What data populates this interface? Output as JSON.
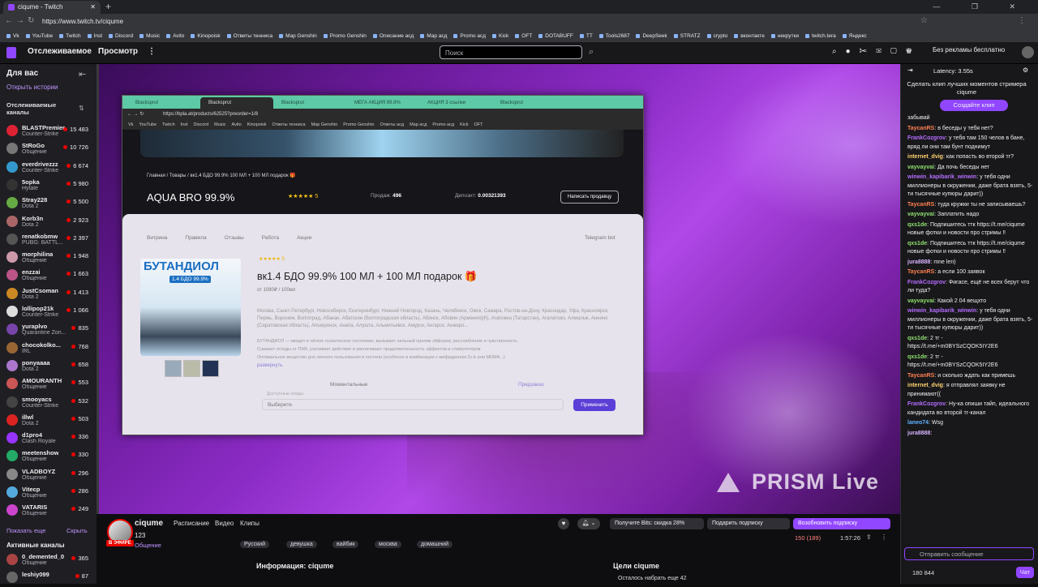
{
  "browser": {
    "tab_title": "ciqume - Twitch",
    "new_tab": "+",
    "url": "https://www.twitch.tv/ciqume",
    "window_controls": "— ❐ ✕",
    "bookmarks": [
      "Vk",
      "YouTube",
      "Twitch",
      "Inst",
      "Discord",
      "Music",
      "Avito",
      "Kinopoisk",
      "Ответы тенниса",
      "Map Genshin",
      "Promo Genshin",
      "Описание асд",
      "Map асд",
      "Promo асд",
      "Kick",
      "OFT",
      "DOTABUFF",
      "TT",
      "Tools2687",
      "DeepSeek",
      "STRATZ",
      "crypto",
      "вконтакте",
      "некрутки",
      "twitch.tera",
      "Яндекс"
    ]
  },
  "topnav": {
    "following": "Отслеживаемое",
    "browse": "Просмотр",
    "more": "⋮",
    "search_placeholder": "Поиск",
    "ad_free": "Без рекламы бесплатно"
  },
  "sidebar": {
    "for_you": "Для вас",
    "history": "Открыть истории",
    "followed_header": "Отслеживаемые каналы",
    "channels": [
      {
        "name": "BLASTPremier",
        "game": "Counter-Strike",
        "viewers": "15 483",
        "color": "#d23"
      },
      {
        "name": "StRoGo",
        "game": "Общение",
        "viewers": "10 726",
        "color": "#777"
      },
      {
        "name": "everdrivezzz",
        "game": "Counter-Strike",
        "viewers": "6 674",
        "color": "#39c"
      },
      {
        "name": "5opka",
        "game": "Hytale",
        "viewers": "5 980",
        "color": "#333"
      },
      {
        "name": "Stray228",
        "game": "Dota 2",
        "viewers": "5 500",
        "color": "#6a4"
      },
      {
        "name": "Korb3n",
        "game": "Dota 2",
        "viewers": "2 923",
        "color": "#a66"
      },
      {
        "name": "renatkobmw",
        "game": "PUBG: BATTL...",
        "viewers": "2 397",
        "color": "#555"
      },
      {
        "name": "morphilina",
        "game": "Общение",
        "viewers": "1 948",
        "color": "#c9a"
      },
      {
        "name": "enzzai",
        "game": "Общение",
        "viewers": "1 663",
        "color": "#b58"
      },
      {
        "name": "JustCsoman",
        "game": "Dota 2",
        "viewers": "1 413",
        "color": "#c82"
      },
      {
        "name": "lollipop21k",
        "game": "Counter-Strike",
        "viewers": "1 066",
        "color": "#ddd"
      },
      {
        "name": "yuraplvo",
        "game": "Quarantine Zon...",
        "viewers": "835",
        "color": "#74a"
      },
      {
        "name": "chocokolko...",
        "game": "IRL",
        "viewers": "768",
        "color": "#963"
      },
      {
        "name": "ponyaaaa",
        "game": "Dota 2",
        "viewers": "658",
        "color": "#a7c"
      },
      {
        "name": "AMOURANTH",
        "game": "Общение",
        "viewers": "553",
        "color": "#c55"
      },
      {
        "name": "smooyacs",
        "game": "Counter-Strike",
        "viewers": "532",
        "color": "#444"
      },
      {
        "name": "illwl",
        "game": "Dota 2",
        "viewers": "503",
        "color": "#d22"
      },
      {
        "name": "d1pro4",
        "game": "Clash Royale",
        "viewers": "336",
        "color": "#93f"
      },
      {
        "name": "meetenshow",
        "game": "Общение",
        "viewers": "330",
        "color": "#2a6"
      },
      {
        "name": "VLADBOYZ",
        "game": "Общение",
        "viewers": "296",
        "color": "#888"
      },
      {
        "name": "Vitecp",
        "game": "Общение",
        "viewers": "286",
        "color": "#5ad"
      },
      {
        "name": "VATARIS",
        "game": "Общение",
        "viewers": "249",
        "color": "#c4c"
      }
    ],
    "show_more": "Показать еще",
    "hide": "Скрыть",
    "active_header": "Активные каналы",
    "active_channels": [
      {
        "name": "0_demented_0",
        "game": "Общение",
        "viewers": "365",
        "color": "#a44"
      },
      {
        "name": "leshiy099",
        "game": "",
        "viewers": "87",
        "color": "#666"
      }
    ]
  },
  "embedded_browser": {
    "tabs": [
      "Blacksprut",
      "Blacksprut",
      "Blacksprut",
      "МЕГА АКЦИЯ 99.9%",
      "АКЦИЯ 3 ссылки",
      "Blacksprut"
    ],
    "url": "https://bpla.at/products/62525?preorder=1/8",
    "bookmarks": [
      "Vk",
      "YouTube",
      "Twitch",
      "Inst",
      "Discord",
      "Music",
      "Avito",
      "Kinopoisk",
      "Ответы тенниса",
      "Map Genshin",
      "Promo Genshin",
      "Ответы асд",
      "Map асд",
      "Promo асд",
      "Kick",
      "OFT"
    ],
    "breadcrumbs": "Главная  /  Товары  /  вк1.4 БДО 99.9% 100 МЛ + 100 МЛ подарок 🎁",
    "shop_title": "AQUA BRO 99.9%",
    "rating": "★★★★★ 5",
    "sales_label": "Продаж:",
    "sales_value": "496",
    "deposit_label": "Депозит:",
    "deposit_value": "0.00321393",
    "seller_button": "Написать продавцу",
    "modal_tabs": [
      "Витрина",
      "Правила",
      "Отзывы",
      "Работа",
      "Акции"
    ],
    "telegram": "Telegram bot",
    "product_image_title": "БУТАНДИОЛ",
    "product_image_subtitle": "1.4 БДО 99.9%",
    "product_title": "вк1.4 БДО 99.9% 100 МЛ + 100 МЛ подарок 🎁",
    "product_stars": "★★★★★ 5",
    "product_price": "от 1080₽ / 100мл",
    "cities": "Москва, Санкт-Петербург, Новосибирск, Екатеринбург, Нижний Новгород, Казань, Челябинск, Омск, Самара, Ростов-на-Дону, Краснодар, Уфа, Красноярск, Пермь, Воронеж, Волгоград, Абакан, Абатское (Волгоградская область), Абинск, Абовян (Армения)(К), Агаповка (Татарстан), Агалатово, Алмалык, Аннино (Саратовская область), Апшеронск, Анапа, Алушта, Альметьевск, Амурск, Ангарск, Анжеро...",
    "features": "БУТАНДИОЛ — вводит в лёгкое психическое состояние, вызывает сильный прилив эйфории, расслабление и чувственность\n Снижает отходы от ПАВ, усиливает действие и увеличивает продолжительность эффектов и стимуляторов\n Оптимальное вещество для личного пользования в постели (особенно в комбинации с мефедроном 2с-b или МDMA...)",
    "more_link": "развернуть",
    "delivery_label": "Моментальные",
    "preorder_label": "Предзаказ",
    "method_label": "Доступные клады",
    "select_placeholder": "Выберите",
    "apply_button": "Применить"
  },
  "overlay": {
    "prism": "PRISM Live"
  },
  "stream_info": {
    "live_badge": "В ЭФИРЕ",
    "streamer": "ciqume",
    "links": [
      "Расписание",
      "Видео",
      "Клипы"
    ],
    "title": "123",
    "category": "Общение",
    "tags": [
      "Русский",
      "девушка",
      "вайбик",
      "москва",
      "домашний"
    ],
    "bits_button": "Получите Bits: скидка 28%",
    "gift_button": "Подарить подписку",
    "sub_button": "Возобновить подписку",
    "viewers": "150 (189)",
    "uptime": "1:57:26",
    "about": "Информация: ciqume",
    "goals": "Цели ciqume",
    "goal_line": "Осталось набрать еще 42"
  },
  "chat": {
    "latency": "Latency: 3.55s",
    "clip_prompt": "Сделать клип лучших моментов стримера ciqume",
    "clip_button": "Создайте клип",
    "messages": [
      {
        "user": "",
        "text": "забывай",
        "color": "#efeff1"
      },
      {
        "user": "TaycanRS",
        "text": "в беседы у тебя нет?",
        "color": "#ff7f50"
      },
      {
        "user": "FrankCozgrov",
        "text": "у тебя там 150 челов в бане, вряд ли они там бунт поднимут",
        "color": "#b56dff"
      },
      {
        "user": "internet_dvig",
        "text": "как попасть во второй тг?",
        "color": "#ffd36e"
      },
      {
        "user": "vayvayvai",
        "text": "Да почь беседы нет",
        "color": "#8fe06d"
      },
      {
        "user": "winwin_kapibarik_winwin",
        "text": "у тебя одни миллионеры в окружении, даже брата взять, 5-ти тысячные купюры дарит))",
        "color": "#b56dff"
      },
      {
        "user": "TaycanRS",
        "text": "туда кружки ты не записываешь?",
        "color": "#ff7f50"
      },
      {
        "user": "vayvayvai",
        "text": "Заплатить надо",
        "color": "#8fe06d"
      },
      {
        "user": "qxs1de",
        "text": "Подпишитесь ттк https://t.me/ciqume новые фотки и новости про стримы ‼",
        "color": "#8fe06d"
      },
      {
        "user": "qxs1de",
        "text": "Подпишитесь ттк https://t.me/ciqume новые фотки и новости про стримы ‼",
        "color": "#8fe06d"
      },
      {
        "user": "jura8888",
        "text": "mne len)",
        "color": "#d9b3ff"
      },
      {
        "user": "TaycanRS",
        "text": "а если 100 заявок",
        "color": "#ff7f50"
      },
      {
        "user": "FrankCozgrov",
        "text": "Фигасе, ещё не всех берут что ли туда?",
        "color": "#b56dff"
      },
      {
        "user": "vayvayvai",
        "text": "Какой 2 04 вещхто",
        "color": "#8fe06d"
      },
      {
        "user": "winwin_kapibarik_winwin",
        "text": "у тебя одни миллионеры в окружении, даже брата взять, 5-ти тысячные купюры дарит))",
        "color": "#b56dff"
      },
      {
        "user": "qxs1de",
        "text": "2 тг - https://t.me/+m0BYSzCQOK5IY2E6",
        "color": "#8fe06d"
      },
      {
        "user": "qxs1de",
        "text": "2 тг - https://t.me/+m0BYSzCQOK5IY2E6",
        "color": "#8fe06d"
      },
      {
        "user": "TaycanRS",
        "text": "и сколько ждать как примешь",
        "color": "#ff7f50"
      },
      {
        "user": "internet_dvig",
        "text": "я отправлял заявку не принимают((",
        "color": "#ffd36e"
      },
      {
        "user": "FrankCozgrov",
        "text": "Ну-ка опиши тайп, идеального кандидата во второй тг-канал",
        "color": "#b56dff"
      },
      {
        "user": "laneo74",
        "text": "Wsg",
        "color": "#5fb3ff"
      },
      {
        "user": "jura8888",
        "text": "",
        "color": "#d9b3ff"
      }
    ],
    "input_placeholder": "Отправить сообщение",
    "points": "180 844",
    "send_button": "Чат"
  }
}
